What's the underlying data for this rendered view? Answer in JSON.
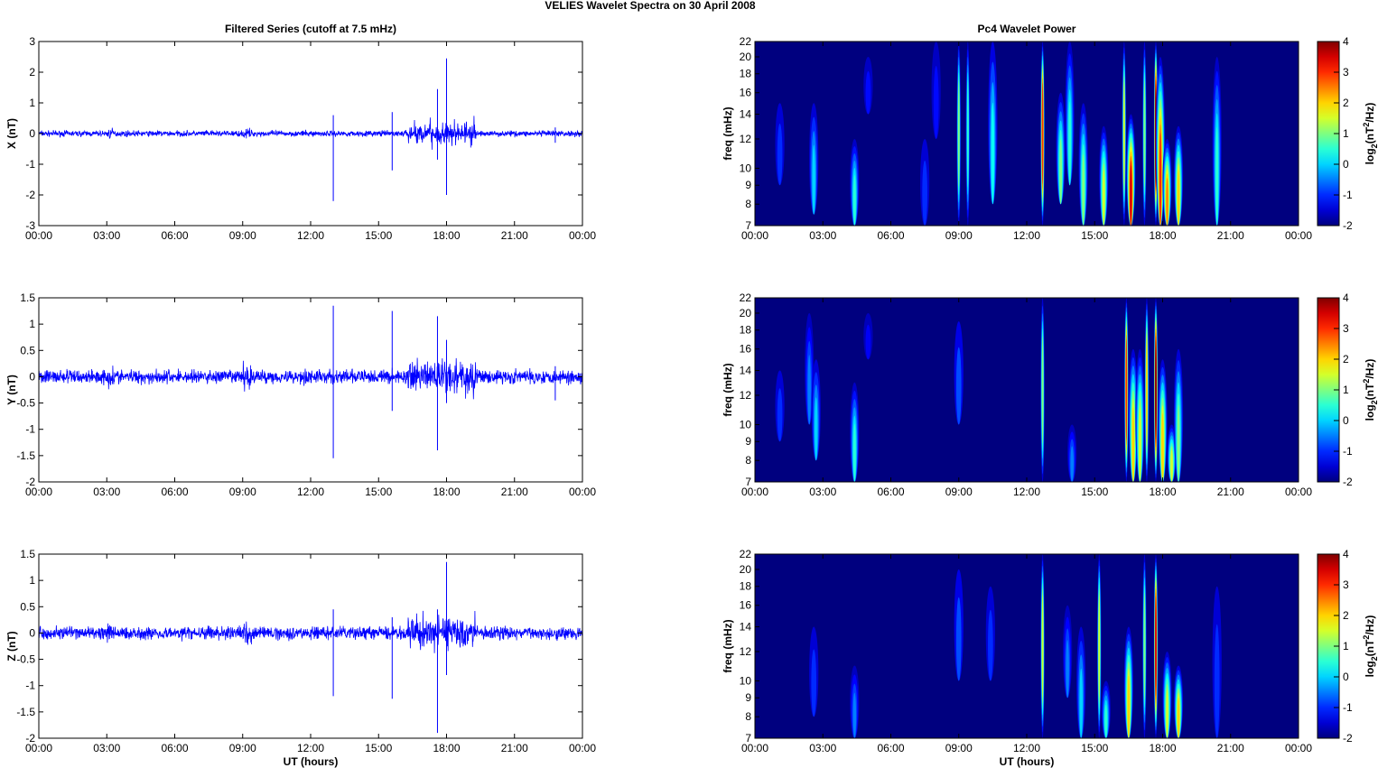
{
  "title": "VELIES Wavelet Spectra on 30 April      2008",
  "chart_data": [
    {
      "type": "line",
      "title": "Filtered Series (cutoff at 7.5 mHz)",
      "ylabel": "X (nT)",
      "xlabel": "",
      "ylim": [
        -3,
        3
      ],
      "yticks": [
        "-3",
        "-2",
        "-1",
        "0",
        "1",
        "2",
        "3"
      ],
      "xlim_hours": [
        0,
        24
      ],
      "xticks": [
        "00:00",
        "03:00",
        "06:00",
        "09:00",
        "12:00",
        "15:00",
        "18:00",
        "21:00",
        "00:00"
      ],
      "color": "#0000ff",
      "noise_amplitude": 0.07,
      "active_interval_hours": [
        16.3,
        19.3
      ],
      "active_amplitude": 0.35,
      "spikes": [
        [
          13.0,
          0.6,
          -2.2
        ],
        [
          15.6,
          0.7,
          -1.2
        ],
        [
          17.6,
          1.45,
          -0.85
        ],
        [
          18.0,
          2.45,
          -2.0
        ],
        [
          22.8,
          0.2,
          -0.3
        ]
      ]
    },
    {
      "type": "heatmap",
      "title": "Pc4 Wavelet Power",
      "ylabel": "freq (mHz)",
      "xlabel": "",
      "ylim": [
        7,
        22
      ],
      "yscale": "log",
      "yticks": [
        "7",
        "8",
        "9",
        "10",
        "12",
        "14",
        "16",
        "18",
        "20",
        "22"
      ],
      "xticks": [
        "00:00",
        "03:00",
        "06:00",
        "09:00",
        "12:00",
        "15:00",
        "18:00",
        "21:00",
        "00:00"
      ],
      "colorbar": {
        "label": "log2(nT2/Hz)",
        "range": [
          -2,
          4
        ],
        "ticks": [
          "-2",
          "-1",
          "0",
          "1",
          "2",
          "3",
          "4"
        ]
      },
      "bursts_hours_fmin_fmax_power": [
        [
          1.1,
          9,
          15,
          -1
        ],
        [
          2.6,
          7.5,
          15,
          0
        ],
        [
          4.4,
          7,
          12,
          0.5
        ],
        [
          5.0,
          14,
          20,
          -1.2
        ],
        [
          7.5,
          7,
          12,
          -1
        ],
        [
          8.0,
          12,
          22,
          -1.2
        ],
        [
          9.0,
          7,
          22,
          1
        ],
        [
          9.4,
          7,
          22,
          0.5
        ],
        [
          10.5,
          8,
          22,
          0.3
        ],
        [
          12.7,
          7,
          22,
          3
        ],
        [
          13.5,
          8,
          16,
          1
        ],
        [
          13.9,
          9,
          22,
          0.5
        ],
        [
          14.5,
          7,
          15,
          1
        ],
        [
          15.4,
          7,
          13,
          1.5
        ],
        [
          16.3,
          7,
          22,
          1.5
        ],
        [
          16.6,
          7,
          14,
          3.5
        ],
        [
          17.2,
          7,
          22,
          1
        ],
        [
          17.7,
          7,
          22,
          4
        ],
        [
          17.9,
          7,
          20,
          3
        ],
        [
          18.2,
          7,
          12,
          2.5
        ],
        [
          18.7,
          7,
          13,
          2
        ],
        [
          20.4,
          7,
          20,
          0.5
        ]
      ]
    },
    {
      "type": "line",
      "title": "",
      "ylabel": "Y (nT)",
      "xlabel": "",
      "ylim": [
        -2,
        1.5
      ],
      "yticks": [
        "-2",
        "-1.5",
        "-1",
        "-0.5",
        "0",
        "0.5",
        "1",
        "1.5"
      ],
      "xlim_hours": [
        0,
        24
      ],
      "xticks": [
        "00:00",
        "03:00",
        "06:00",
        "09:00",
        "12:00",
        "15:00",
        "18:00",
        "21:00",
        "00:00"
      ],
      "color": "#0000ff",
      "noise_amplitude": 0.1,
      "active_interval_hours": [
        16.3,
        19.3
      ],
      "active_amplitude": 0.35,
      "spikes": [
        [
          13.0,
          1.35,
          -1.55
        ],
        [
          15.6,
          1.25,
          -0.65
        ],
        [
          17.6,
          1.15,
          -1.4
        ],
        [
          18.0,
          0.7,
          -0.5
        ],
        [
          22.8,
          0.2,
          -0.45
        ]
      ]
    },
    {
      "type": "heatmap",
      "title": "",
      "ylabel": "freq (mHz)",
      "xlabel": "",
      "ylim": [
        7,
        22
      ],
      "yscale": "log",
      "yticks": [
        "7",
        "8",
        "9",
        "10",
        "12",
        "14",
        "16",
        "18",
        "20",
        "22"
      ],
      "xticks": [
        "00:00",
        "03:00",
        "06:00",
        "09:00",
        "12:00",
        "15:00",
        "18:00",
        "21:00",
        "00:00"
      ],
      "colorbar": {
        "label": "log2(nT2/Hz)",
        "range": [
          -2,
          4
        ],
        "ticks": [
          "-2",
          "-1",
          "0",
          "1",
          "2",
          "3",
          "4"
        ]
      },
      "bursts_hours_fmin_fmax_power": [
        [
          1.1,
          9,
          14,
          -1
        ],
        [
          2.4,
          10,
          20,
          -0.5
        ],
        [
          2.7,
          8,
          15,
          0
        ],
        [
          4.4,
          7,
          13,
          0.5
        ],
        [
          5.0,
          15,
          20,
          -1.3
        ],
        [
          9.0,
          10,
          19,
          -0.8
        ],
        [
          12.7,
          7,
          22,
          1
        ],
        [
          14.0,
          7,
          10,
          -0.5
        ],
        [
          16.4,
          7,
          22,
          3
        ],
        [
          16.7,
          7,
          16,
          2
        ],
        [
          17.0,
          7,
          16,
          1.5
        ],
        [
          17.3,
          7,
          22,
          2
        ],
        [
          17.7,
          7,
          22,
          4
        ],
        [
          18.0,
          7,
          15,
          2
        ],
        [
          18.4,
          7,
          10,
          1.5
        ],
        [
          18.7,
          7,
          16,
          1
        ]
      ]
    },
    {
      "type": "line",
      "title": "",
      "ylabel": "Z (nT)",
      "xlabel": "UT (hours)",
      "ylim": [
        -2,
        1.5
      ],
      "yticks": [
        "-2",
        "-1.5",
        "-1",
        "-0.5",
        "0",
        "0.5",
        "1",
        "1.5"
      ],
      "xlim_hours": [
        0,
        24
      ],
      "xticks": [
        "00:00",
        "03:00",
        "06:00",
        "09:00",
        "12:00",
        "15:00",
        "18:00",
        "21:00",
        "00:00"
      ],
      "color": "#0000ff",
      "noise_amplitude": 0.09,
      "active_interval_hours": [
        16.3,
        19.3
      ],
      "active_amplitude": 0.3,
      "spikes": [
        [
          13.0,
          0.45,
          -1.2
        ],
        [
          15.6,
          0.3,
          -1.25
        ],
        [
          17.6,
          0.45,
          -1.9
        ],
        [
          18.0,
          1.35,
          -0.8
        ]
      ]
    },
    {
      "type": "heatmap",
      "title": "",
      "ylabel": "freq (mHz)",
      "xlabel": "UT (hours)",
      "ylim": [
        7,
        22
      ],
      "yscale": "log",
      "yticks": [
        "7",
        "8",
        "9",
        "10",
        "12",
        "14",
        "16",
        "18",
        "20",
        "22"
      ],
      "xticks": [
        "00:00",
        "03:00",
        "06:00",
        "09:00",
        "12:00",
        "15:00",
        "18:00",
        "21:00",
        "00:00"
      ],
      "colorbar": {
        "label": "log2(nT2/Hz)",
        "range": [
          -2,
          4
        ],
        "ticks": [
          "-2",
          "-1",
          "0",
          "1",
          "2",
          "3",
          "4"
        ]
      },
      "bursts_hours_fmin_fmax_power": [
        [
          2.6,
          8,
          14,
          -1
        ],
        [
          4.4,
          7,
          11,
          -0.5
        ],
        [
          9.0,
          10,
          20,
          -0.8
        ],
        [
          10.4,
          10,
          18,
          -1
        ],
        [
          12.7,
          7,
          22,
          1.5
        ],
        [
          13.8,
          9,
          16,
          -0.5
        ],
        [
          14.4,
          7,
          14,
          0
        ],
        [
          15.2,
          7,
          22,
          1.5
        ],
        [
          15.5,
          7,
          10,
          0.5
        ],
        [
          16.5,
          7,
          14,
          2
        ],
        [
          17.2,
          7,
          22,
          1
        ],
        [
          17.7,
          7,
          22,
          3.5
        ],
        [
          18.2,
          7,
          12,
          1.5
        ],
        [
          18.7,
          7,
          11,
          2
        ],
        [
          20.4,
          7,
          18,
          -1
        ]
      ]
    }
  ]
}
